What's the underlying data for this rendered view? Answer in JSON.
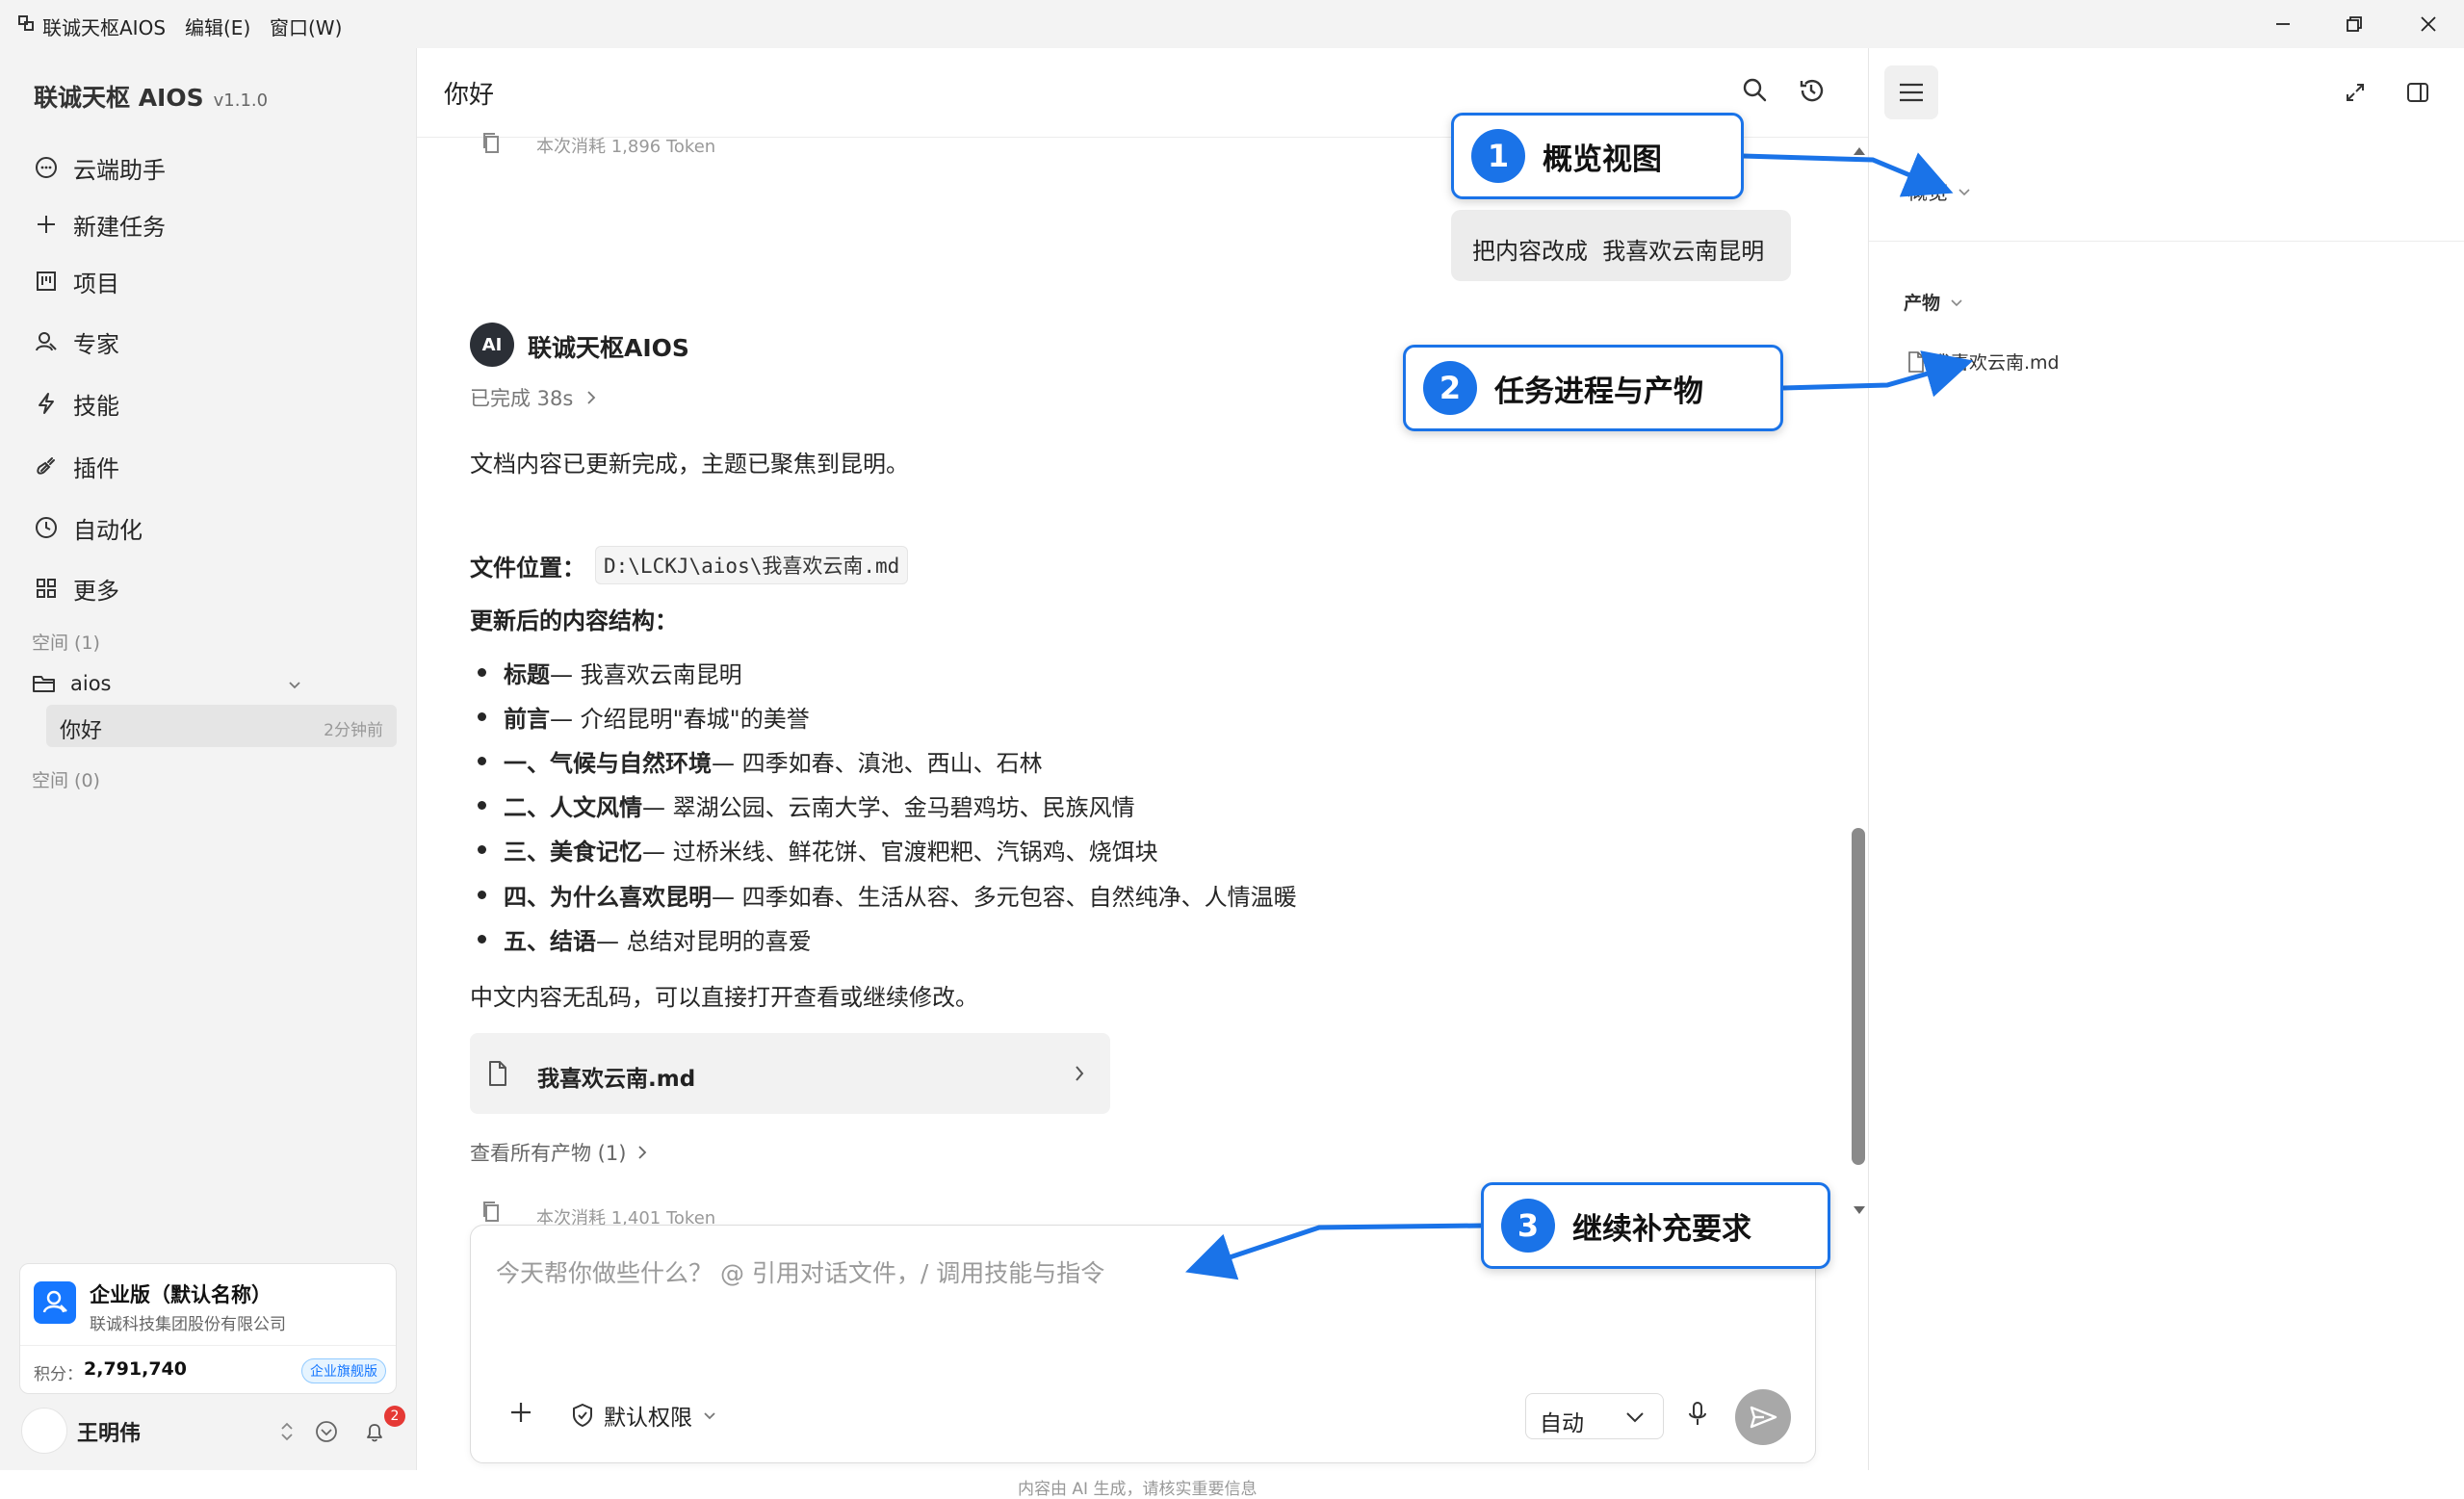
{
  "titlebar": {
    "app_name": "联诚天枢AIOS",
    "menu_edit": "编辑(E)",
    "menu_window": "窗口(W)"
  },
  "sidebar": {
    "brand": "联诚天枢 AIOS",
    "version": "v1.1.0",
    "nav": [
      {
        "label": "云端助手",
        "icon": "chat-bubble-icon"
      },
      {
        "label": "新建任务",
        "icon": "plus-icon"
      },
      {
        "label": "项目",
        "icon": "kanban-icon"
      },
      {
        "label": "专家",
        "icon": "person-icon"
      },
      {
        "label": "技能",
        "icon": "lightning-icon"
      },
      {
        "label": "插件",
        "icon": "plug-icon"
      },
      {
        "label": "自动化",
        "icon": "clock-icon"
      },
      {
        "label": "更多",
        "icon": "grid-icon"
      }
    ],
    "space_label_1": "空间 (1)",
    "folder_name": "aios",
    "conversation_title": "你好",
    "conversation_time": "2分钟前",
    "space_label_0": "空间 (0)",
    "org": {
      "name": "企业版（默认名称）",
      "company": "联诚科技集团股份有限公司",
      "points_label": "积分：",
      "points_value": "2,791,740",
      "badge": "企业旗舰版"
    },
    "user": {
      "name": "王明伟",
      "notification_count": "2"
    }
  },
  "main": {
    "title": "你好",
    "prev_token_text": "本次消耗 1,896 Token",
    "user_message": "把内容改成  我喜欢云南昆明",
    "ai_name": "联诚天枢AIOS",
    "ai_avatar": "AI",
    "status": "已完成 38s",
    "intro": "文档内容已更新完成，主题已聚焦到昆明。",
    "file_location_label": "文件位置：",
    "file_path": "D:\\LCKJ\\aios\\我喜欢云南.md",
    "structure_heading": "更新后的内容结构：",
    "bullets": [
      {
        "bold": "标题",
        "text": " — 我喜欢云南昆明"
      },
      {
        "bold": "前言",
        "text": " — 介绍昆明\"春城\"的美誉"
      },
      {
        "bold": "一、气候与自然环境",
        "text": " — 四季如春、滇池、西山、石林"
      },
      {
        "bold": "二、人文风情",
        "text": " — 翠湖公园、云南大学、金马碧鸡坊、民族风情"
      },
      {
        "bold": "三、美食记忆",
        "text": " — 过桥米线、鲜花饼、官渡粑粑、汽锅鸡、烧饵块"
      },
      {
        "bold": "四、为什么喜欢昆明",
        "text": " — 四季如春、生活从容、多元包容、自然纯净、人情温暖"
      },
      {
        "bold": "五、结语",
        "text": " — 总结对昆明的喜爱"
      }
    ],
    "closing": "中文内容无乱码，可以直接打开查看或继续修改。",
    "file_card_name": "我喜欢云南.md",
    "view_all": "查看所有产物 (1)",
    "token_text": "本次消耗 1,401 Token",
    "input_placeholder": "今天帮你做些什么？ @ 引用对话文件，/ 调用技能与指令",
    "permission": "默认权限",
    "mode": "自动",
    "disclaimer": "内容由 AI 生成，请核实重要信息"
  },
  "rightpanel": {
    "overview_label": "概览",
    "artifacts_label": "产物",
    "artifact_file": "我喜欢云南.md"
  },
  "callouts": [
    {
      "num": "1",
      "text": "概览视图"
    },
    {
      "num": "2",
      "text": "任务进程与产物"
    },
    {
      "num": "3",
      "text": "继续补充要求"
    }
  ],
  "colors": {
    "accent": "#1a73e8",
    "sidebar_bg": "#f3f3f3",
    "badge_blue": "#1677ff"
  }
}
